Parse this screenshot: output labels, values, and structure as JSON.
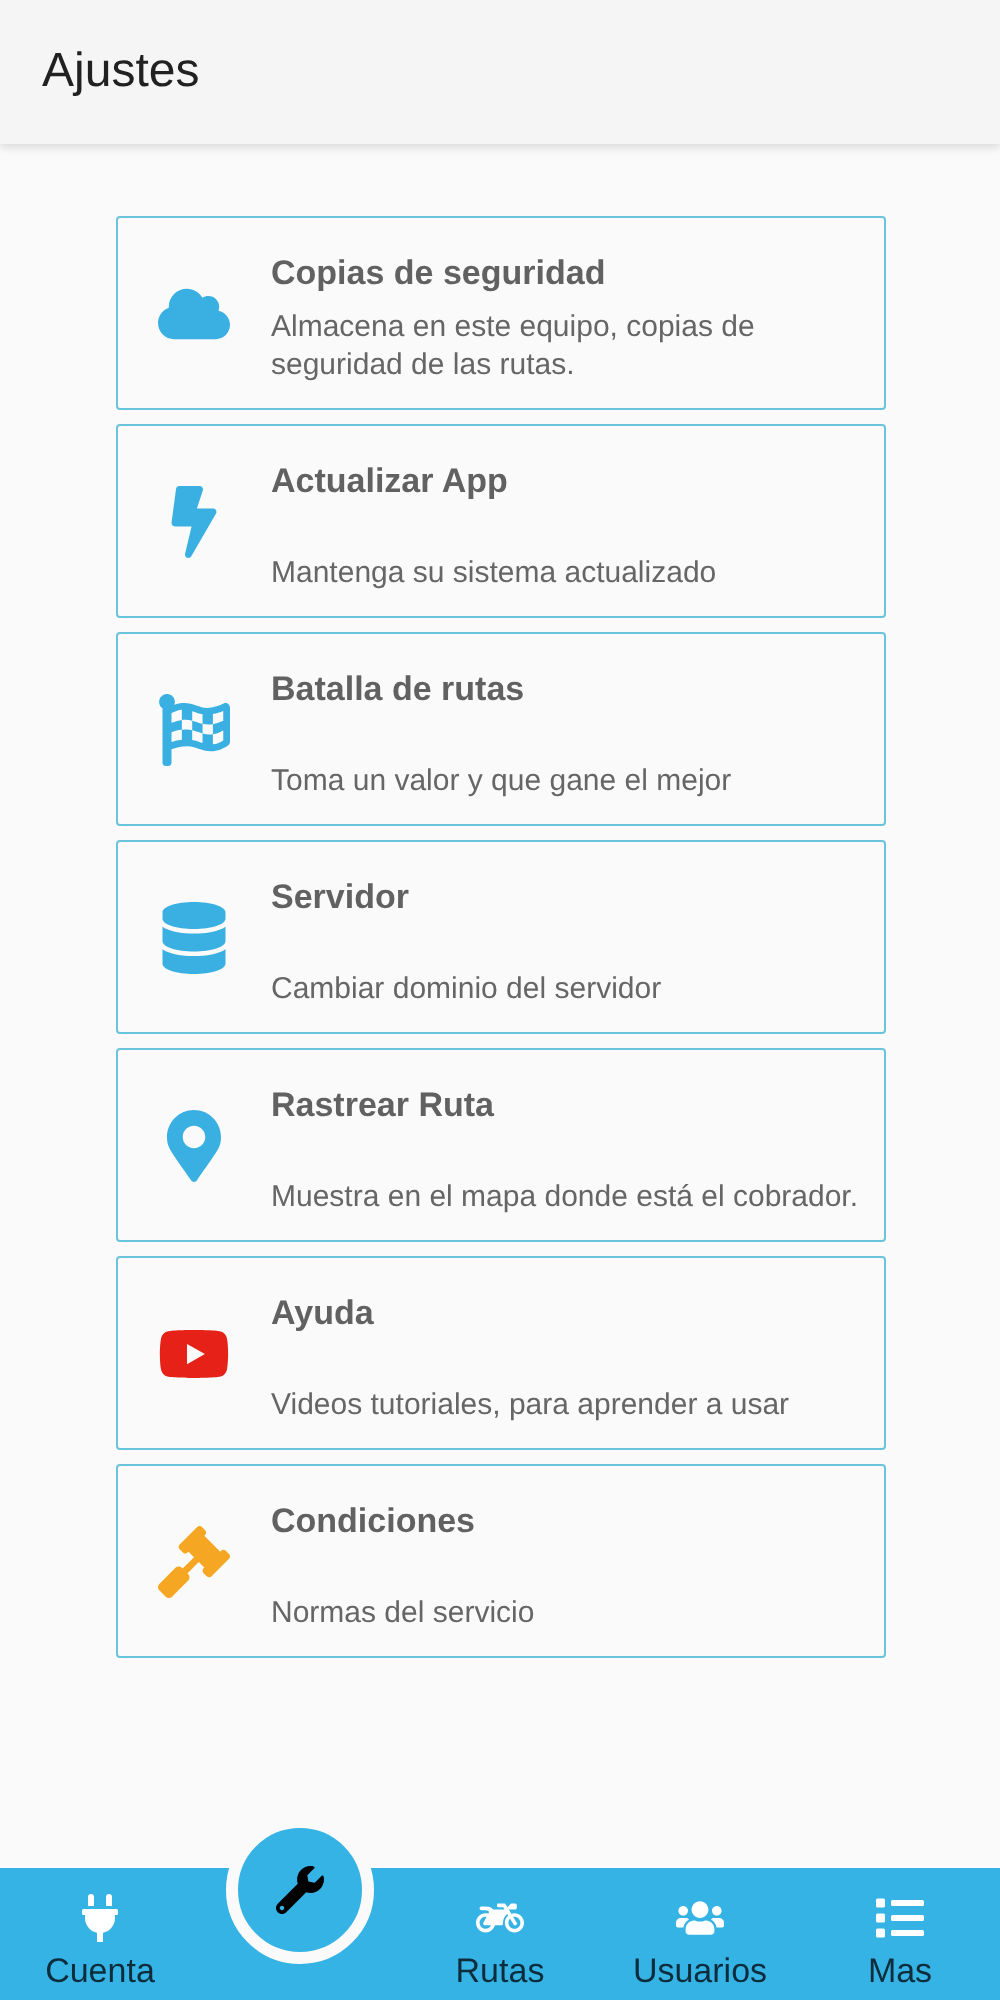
{
  "header": {
    "title": "Ajustes"
  },
  "options": [
    {
      "kind": "cloud",
      "title": "Copias de seguridad",
      "description": "Almacena en este equipo, copias de seguridad de las rutas."
    },
    {
      "kind": "bolt",
      "title": "Actualizar App",
      "description": "Mantenga su sistema actualizado"
    },
    {
      "kind": "flag",
      "title": "Batalla de rutas",
      "description": "Toma un valor y que gane el mejor"
    },
    {
      "kind": "database",
      "title": "Servidor",
      "description": "Cambiar dominio del servidor"
    },
    {
      "kind": "pin",
      "title": "Rastrear Ruta",
      "description": "Muestra en el mapa donde está el cobrador."
    },
    {
      "kind": "video",
      "title": "Ayuda",
      "description": "Videos tutoriales, para aprender a usar"
    },
    {
      "kind": "gavel",
      "title": "Condiciones",
      "description": "Normas del servicio"
    }
  ],
  "bottom_nav": [
    {
      "kind": "plug",
      "label": "Cuenta",
      "selected": false
    },
    {
      "kind": "wrench",
      "selected": true
    },
    {
      "kind": "motorcycle",
      "label": "Rutas",
      "selected": false
    },
    {
      "kind": "users",
      "label": "Usuarios",
      "selected": false
    },
    {
      "kind": "list",
      "label": "Mas",
      "selected": false
    }
  ]
}
